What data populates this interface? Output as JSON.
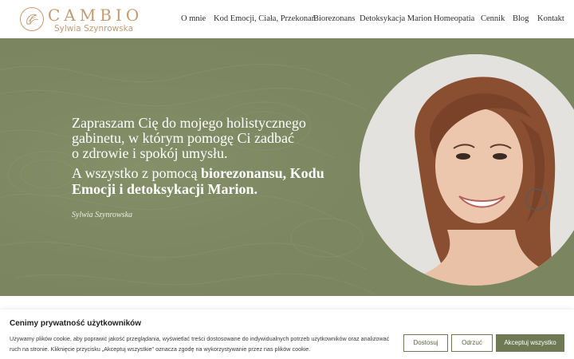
{
  "brand": {
    "name": "CAMBIO",
    "subtitle": "Sylwia Szynrowska",
    "accent_color": "#c49a72"
  },
  "nav": {
    "items": [
      {
        "label": "O mnie"
      },
      {
        "label": "Kod Emocji, Ciała, Przekonań"
      },
      {
        "label": "Biorezonans"
      },
      {
        "label": "Detoksykacja Marion"
      },
      {
        "label": "Homeopatia"
      },
      {
        "label": "Cennik"
      },
      {
        "label": "Blog"
      },
      {
        "label": "Kontakt"
      }
    ]
  },
  "hero": {
    "background_color": "#7b855f",
    "intro_lines": [
      "Zapraszam Cię do mojego holistycznego",
      "gabinetu, w którym pomogę Ci zadbać",
      "o zdrowie i spokój umysłu."
    ],
    "tagline": {
      "lead": "A wszystko z pomocą ",
      "bold_1": "biorezonansu, Kodu",
      "bold_2": "Emocji i detoksykacji Marion."
    },
    "signature": "Sylwia Szynrowska",
    "portrait_icon": "portrait-photo"
  },
  "cookie": {
    "title": "Cenimy prywatność użytkowników",
    "text": "Używamy plików cookie, aby poprawić jakość przeglądania, wyświetlać treści dostosowane do indywidualnych potrzeb użytkowników oraz analizować ruch na stronie. Kliknięcie przycisku „Akceptuj wszystkie\" oznacza zgodę na wykorzystywanie przez nas plików cookie.",
    "buttons": {
      "customize": "Dostosuj",
      "reject": "Odrzuć",
      "accept": "Akceptuj wszystko"
    },
    "button_color": "#6f7a55"
  }
}
